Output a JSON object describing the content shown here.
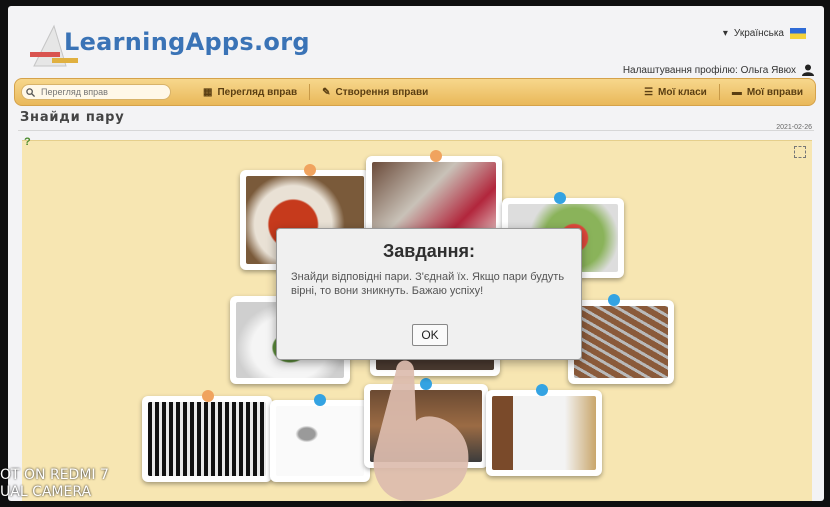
{
  "header": {
    "logo_text": "LearningApps.org",
    "language": "Українська",
    "profile_text": "Налаштування профілю: Ольга Явюх"
  },
  "navbar": {
    "search_placeholder": "Перегляд вправ",
    "browse_label": "Перегляд вправ",
    "create_label": "Створення вправи",
    "classes_label": "Мої класи",
    "my_exercises_label": "Мої вправи"
  },
  "page": {
    "title": "Знайди пару",
    "date": "2021-02-26"
  },
  "dialog": {
    "heading": "Завдання:",
    "text": "Знайди відповідні пари. З'єднай їх. Якщо пари будуть вірні, то вони зникнуть. Бажаю успіху!",
    "ok_label": "OK"
  },
  "watermark": {
    "line1": "OT ON REDMI 7",
    "line2": "UAL CAMERA"
  },
  "colors": {
    "navbar": "#e9b85a",
    "board": "#f7e6b2",
    "pin_blue": "#34a3e2",
    "pin_orange": "#f0a35e",
    "logo_blue": "#3a73b6"
  },
  "icons": [
    "search-icon",
    "grid-icon",
    "pencil-icon",
    "list-icon",
    "folder-icon",
    "user-icon",
    "help-icon",
    "fullscreen-icon",
    "flag-icon"
  ]
}
